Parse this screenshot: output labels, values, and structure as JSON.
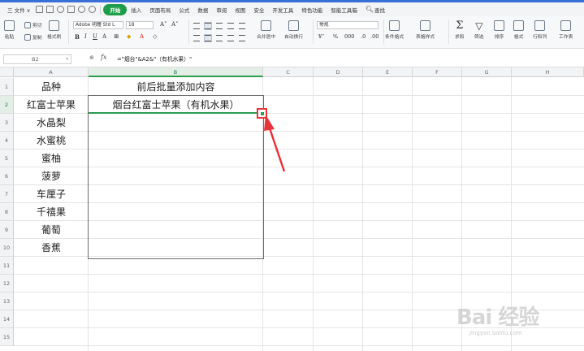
{
  "menubar": {
    "file_label": "三 文件 ∨",
    "tabs": [
      "开始",
      "插入",
      "页面布局",
      "公式",
      "数据",
      "审阅",
      "视图",
      "安全",
      "开发工具",
      "特色功能",
      "智能工具箱"
    ],
    "active_tab": "开始",
    "search_label": "查找"
  },
  "ribbon": {
    "paste": "粘贴",
    "cut": "剪切",
    "copy": "复制",
    "format_painter": "格式刷",
    "font_name": "Adobe 明體 Std L",
    "font_size": "18",
    "merge_center": "合并居中",
    "wrap_text": "自动换行",
    "number_format": "常规",
    "conditional_format": "条件格式",
    "table_style": "表格样式",
    "sum": "求和",
    "filter": "筛选",
    "sort": "排序",
    "format": "格式",
    "rows_cols": "行和列",
    "worksheet": "工作表"
  },
  "formula_bar": {
    "cell_ref": "B2",
    "fx": "fx",
    "formula": "=\"烟台\"&A2&\"（有机水果）\""
  },
  "sheet": {
    "columns": [
      "A",
      "B",
      "C",
      "D",
      "E",
      "F",
      "G",
      "H"
    ],
    "selected_column": "B",
    "rows": [
      "1",
      "2",
      "3",
      "4",
      "5",
      "6",
      "7",
      "8",
      "9",
      "10",
      "11",
      "12",
      "13",
      "14",
      "15"
    ],
    "selected_row": "2",
    "header_a": "品种",
    "header_b": "前后批量添加内容",
    "col_a": [
      "红富士苹果",
      "水晶梨",
      "水蜜桃",
      "蜜柚",
      "菠萝",
      "车厘子",
      "千禧果",
      "葡萄",
      "香蕉"
    ],
    "b2": "烟台红富士苹果（有机水果）"
  },
  "watermark": {
    "logo_text": "Bai 经验",
    "sub_text": "jingyan.baidu.com"
  },
  "colors": {
    "accent_green": "#2a9d4f",
    "arrow_red": "#e8343c"
  }
}
